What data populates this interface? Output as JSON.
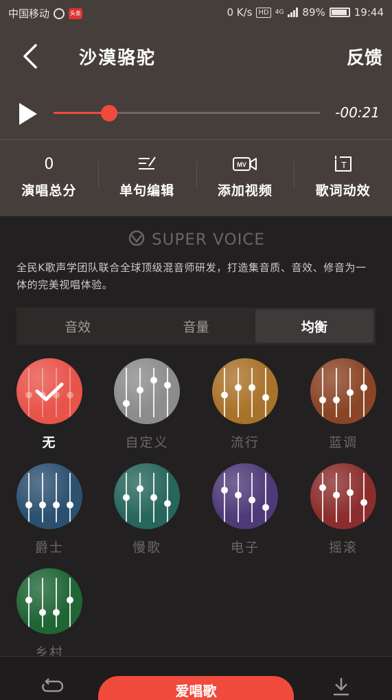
{
  "status_bar": {
    "carrier": "中国移动",
    "app_badge": "头条",
    "net_speed": "0 K/s",
    "hd": "HD",
    "network": "4G",
    "battery": "89%",
    "time": "19:44"
  },
  "header": {
    "title": "沙漠骆驼",
    "feedback_label": "反馈"
  },
  "player": {
    "time_remaining": "-00:21",
    "progress": 0.21
  },
  "tools": [
    {
      "top": "0",
      "label": "演唱总分",
      "icon": "score-text"
    },
    {
      "top": "",
      "label": "单句编辑",
      "icon": "edit-icon"
    },
    {
      "top": "MV",
      "label": "添加视频",
      "icon": "video-icon"
    },
    {
      "top": "T",
      "label": "歌词动效",
      "icon": "lyrics-effect-icon"
    }
  ],
  "super_voice": {
    "logo_text": "SUPER VOICE",
    "description": "全民K歌声学团队联合全球顶级混音师研发，打造集音质、音效、修音为一体的完美视唱体验。"
  },
  "tabs": [
    {
      "label": "音效",
      "active": false
    },
    {
      "label": "音量",
      "active": false
    },
    {
      "label": "均衡",
      "active": true
    }
  ],
  "presets": [
    {
      "label": "无",
      "color": "#e8534a",
      "selected": true,
      "levels": [
        0.45,
        0.45,
        0.45,
        0.45
      ]
    },
    {
      "label": "自定义",
      "color": "#8c8c8c",
      "selected": false,
      "levels": [
        0.28,
        0.55,
        0.75,
        0.65
      ]
    },
    {
      "label": "流行",
      "color": "#a9722a",
      "selected": false,
      "levels": [
        0.45,
        0.6,
        0.6,
        0.4
      ]
    },
    {
      "label": "蓝调",
      "color": "#8a4526",
      "selected": false,
      "levels": [
        0.35,
        0.35,
        0.5,
        0.6
      ]
    },
    {
      "label": "爵士",
      "color": "#2c5070",
      "selected": false,
      "levels": [
        0.35,
        0.35,
        0.35,
        0.35
      ]
    },
    {
      "label": "慢歌",
      "color": "#27665c",
      "selected": false,
      "levels": [
        0.5,
        0.68,
        0.5,
        0.38
      ]
    },
    {
      "label": "电子",
      "color": "#4e3a78",
      "selected": false,
      "levels": [
        0.65,
        0.55,
        0.45,
        0.3
      ]
    },
    {
      "label": "摇滚",
      "color": "#8c2d2d",
      "selected": false,
      "levels": [
        0.7,
        0.55,
        0.6,
        0.4
      ]
    },
    {
      "label": "乡村",
      "color": "#1f6535",
      "selected": false,
      "levels": [
        0.55,
        0.3,
        0.3,
        0.55
      ]
    }
  ],
  "bottom": {
    "main_label": "爱唱歌"
  }
}
